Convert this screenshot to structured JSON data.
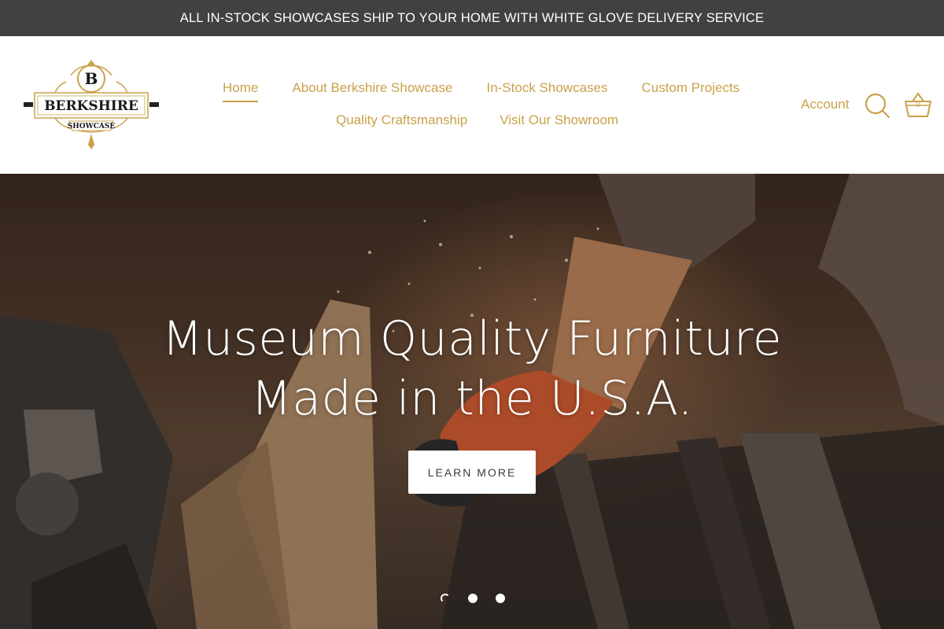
{
  "announcement": {
    "text": "ALL IN-STOCK SHOWCASES SHIP TO YOUR HOME WITH WHITE GLOVE DELIVERY SERVICE"
  },
  "logo": {
    "monogram": "B",
    "name": "BERKSHIRE",
    "tagline": "SHOWCASE"
  },
  "nav": {
    "row1": [
      {
        "label": "Home",
        "active": true
      },
      {
        "label": "About Berkshire Showcase"
      },
      {
        "label": "In-Stock Showcases"
      },
      {
        "label": "Custom Projects"
      }
    ],
    "row2": [
      {
        "label": "Quality Craftsmanship"
      },
      {
        "label": "Visit Our Showroom"
      }
    ]
  },
  "header_actions": {
    "account_label": "Account",
    "search_icon": "search-icon",
    "cart_icon": "basket-icon",
    "cart_count": "0"
  },
  "hero": {
    "title_line1": "Museum Quality Furniture",
    "title_line2": "Made in the U.S.A.",
    "button_label": "LEARN MORE",
    "slide_count": 3,
    "active_slide": 1
  },
  "colors": {
    "accent": "#c9a24a",
    "announcement_bg": "#414141",
    "text_dark": "#3b3b3b"
  }
}
